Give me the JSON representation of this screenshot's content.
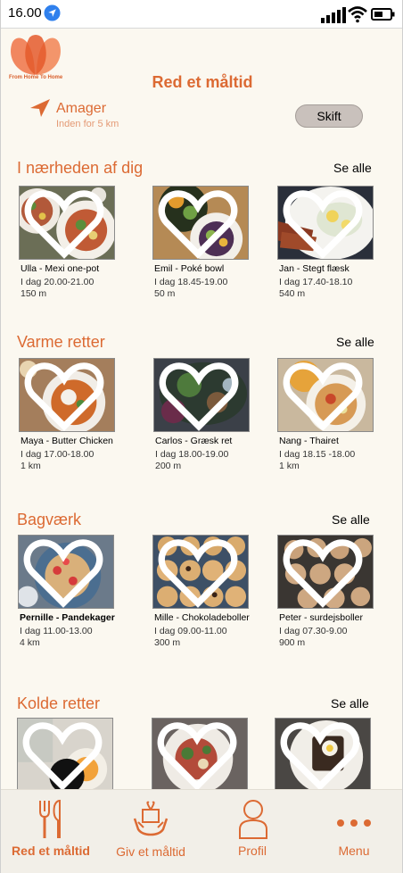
{
  "status_bar": {
    "time": "16.00"
  },
  "header": {
    "logo_text": "From Home To Home",
    "title": "Red et måltid",
    "location_name": "Amager",
    "location_radius": "Inden for 5 km",
    "change_button": "Skift"
  },
  "sections": [
    {
      "title": "I nærheden af dig",
      "see_all": "Se alle",
      "items": [
        {
          "name": "Ulla - Mexi one-pot",
          "time": "I dag 20.00-21.00",
          "distance": "150 m"
        },
        {
          "name": "Emil - Poké bowl",
          "time": "I dag 18.45-19.00",
          "distance": "50 m"
        },
        {
          "name": "Jan - Stegt flæsk",
          "time": "I dag 17.40-18.10",
          "distance": "540 m"
        }
      ]
    },
    {
      "title": "Varme retter",
      "see_all": "Se alle",
      "items": [
        {
          "name": "Maya - Butter Chicken",
          "time": "I dag 17.00-18.00",
          "distance": "1 km"
        },
        {
          "name": "Carlos - Græsk ret",
          "time": "I dag 18.00-19.00",
          "distance": "200 m"
        },
        {
          "name": "Nang - Thairet",
          "time": "I dag 18.15 -18.00",
          "distance": "1 km"
        }
      ]
    },
    {
      "title": "Bagværk",
      "see_all": "Se alle",
      "items": [
        {
          "name": "Pernille - Pandekager",
          "time": "I dag 11.00-13.00",
          "distance": "4 km"
        },
        {
          "name": "Mille - Chokoladeboller",
          "time": "I dag 09.00-11.00",
          "distance": "300 m"
        },
        {
          "name": "Peter - surdejsboller",
          "time": "I dag 07.30-9.00",
          "distance": "900 m"
        }
      ]
    },
    {
      "title": "Kolde retter",
      "see_all": "Se alle",
      "items": [
        {
          "name": "",
          "time": "",
          "distance": ""
        },
        {
          "name": "",
          "time": "",
          "distance": ""
        },
        {
          "name": "",
          "time": "",
          "distance": ""
        }
      ]
    }
  ],
  "bottom_nav": [
    {
      "label": "Red et måltid",
      "icon": "cutlery-icon",
      "active": true
    },
    {
      "label": "Giv et måltid",
      "icon": "give-meal-icon",
      "active": false
    },
    {
      "label": "Profil",
      "icon": "profile-icon",
      "active": false
    },
    {
      "label": "Menu",
      "icon": "more-dots-icon",
      "active": false
    }
  ],
  "colors": {
    "accent": "#dc6a33",
    "background": "#fbf8f0",
    "button": "#c9c1bc"
  }
}
